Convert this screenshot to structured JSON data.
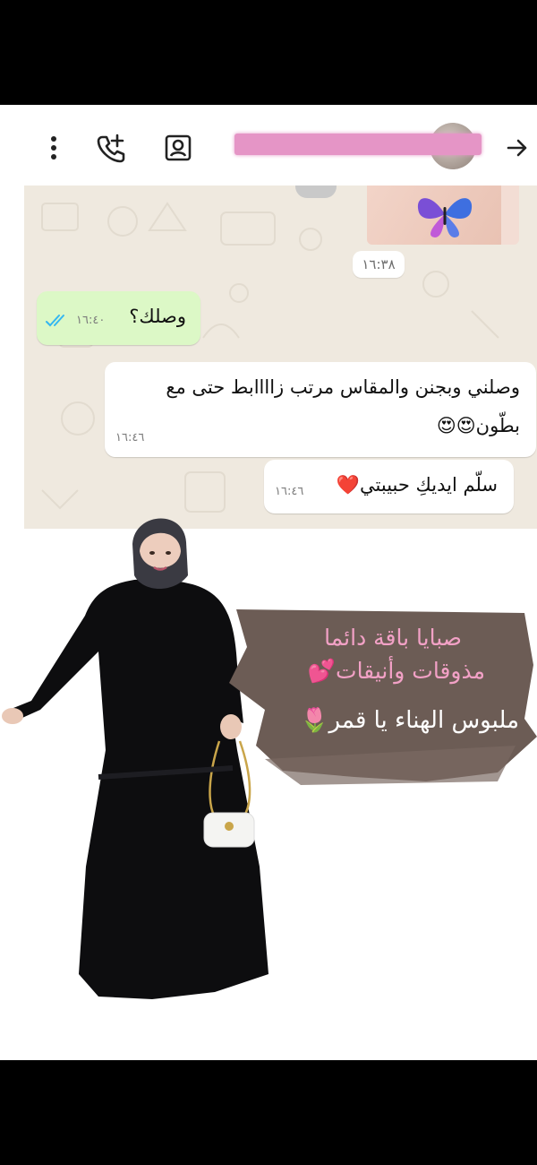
{
  "header": {
    "back_icon": "arrow-right-icon",
    "contact_icon": "contact-card-icon",
    "add_call_icon": "phone-plus-icon",
    "menu_icon": "more-vertical-icon"
  },
  "chat": {
    "date_separator": "١٦:٣٨",
    "messages": [
      {
        "type": "outgoing",
        "text": "وصلك؟",
        "time": "١٦:٤٠",
        "status_icon": "double-check-icon"
      },
      {
        "type": "incoming",
        "line1": "وصلني وبجنن والمقاس مرتب زاااابط حتى مع",
        "line2": "بطّون😍😍",
        "time": "١٦:٤٦"
      },
      {
        "type": "incoming",
        "text": "سلّم ايديكِ حبيبتي❤️",
        "time": "١٦:٤٦"
      }
    ]
  },
  "promo": {
    "line1": "صبايا باقة دائما",
    "line2": "مذوقات وأنيقات💕",
    "line3": "ملبوس الهناء يا قمر🌷"
  },
  "colors": {
    "outgoing_bubble": "#dcf8c6",
    "chat_background": "#efe9df",
    "read_check": "#34b7f1",
    "promo_pink": "#f2a1c6"
  }
}
